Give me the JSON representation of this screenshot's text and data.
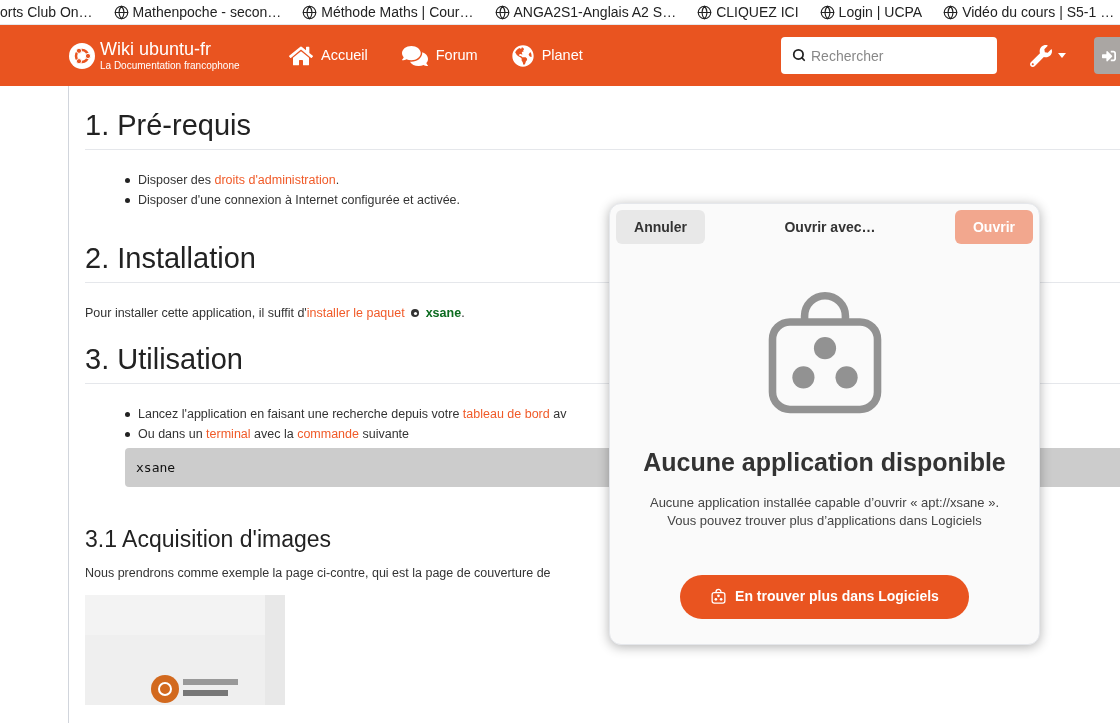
{
  "bookmarks": [
    {
      "label": "orts Club On…",
      "icon": false
    },
    {
      "label": "Mathenpoche - secon…",
      "icon": true
    },
    {
      "label": "Méthode Maths | Cour…",
      "icon": true
    },
    {
      "label": "ANGA2S1-Anglais A2 S…",
      "icon": true
    },
    {
      "label": "CLIQUEZ ICI",
      "icon": true
    },
    {
      "label": "Login | UCPA",
      "icon": true
    },
    {
      "label": "Vidéo du cours | S5-1 …",
      "icon": true
    }
  ],
  "header": {
    "site_title": "Wiki ubuntu-fr",
    "site_subtitle": "La Documentation francophone",
    "nav": [
      {
        "label": "Accueil",
        "kind": "home"
      },
      {
        "label": "Forum",
        "kind": "forum"
      },
      {
        "label": "Planet",
        "kind": "planet"
      }
    ],
    "search": {
      "placeholder": "Rechercher"
    }
  },
  "content": [
    {
      "kind": "heading",
      "text": "1. Pré-requis"
    },
    {
      "kind": "bullets",
      "items": [
        [
          {
            "kind": "plain",
            "text": "Disposer des "
          },
          {
            "kind": "link",
            "text": "droits d'administration"
          },
          {
            "kind": "plain",
            "text": "."
          }
        ],
        [
          {
            "kind": "plain",
            "text": "Disposer d'une connexion à Internet configurée et activée."
          }
        ]
      ]
    },
    {
      "kind": "heading",
      "text": "2. Installation"
    },
    {
      "kind": "paragraph",
      "runs": [
        {
          "kind": "plain",
          "text": "Pour installer cette application, il suffit d'"
        },
        {
          "kind": "link",
          "text": "installer le paquet"
        },
        {
          "kind": "package",
          "text": "xsane"
        },
        {
          "kind": "plain",
          "text": "."
        }
      ]
    },
    {
      "kind": "heading",
      "text": "3. Utilisation"
    },
    {
      "kind": "bullets",
      "items": [
        [
          {
            "kind": "plain",
            "text": "Lancez l'application en faisant une recherche depuis votre "
          },
          {
            "kind": "link",
            "text": "tableau de bord"
          },
          {
            "kind": "plain",
            "text": " av"
          }
        ],
        [
          {
            "kind": "plain",
            "text": "Ou dans un "
          },
          {
            "kind": "link",
            "text": "terminal"
          },
          {
            "kind": "plain",
            "text": " avec la "
          },
          {
            "kind": "link",
            "text": "commande"
          },
          {
            "kind": "plain",
            "text": " suivante"
          }
        ]
      ]
    },
    {
      "kind": "code",
      "text": "xsane"
    },
    {
      "kind": "subheading",
      "text": "3.1 Acquisition d'images"
    },
    {
      "kind": "paragraph",
      "runs": [
        {
          "kind": "plain",
          "text": "Nous prendrons comme exemple la page ci-contre, qui est la page de couverture de"
        }
      ]
    },
    {
      "kind": "picture"
    }
  ],
  "dialog": {
    "cancel": "Annuler",
    "title": "Ouvrir avec…",
    "open": {
      "label": "Ouvrir",
      "disabled": true
    },
    "heading": "Aucune application disponible",
    "message": [
      "Aucune application installée capable d’ouvrir « apt://xsane ».",
      "Vous pouvez trouver plus d’applications dans Logiciels"
    ],
    "action": "En trouver plus dans Logiciels"
  }
}
